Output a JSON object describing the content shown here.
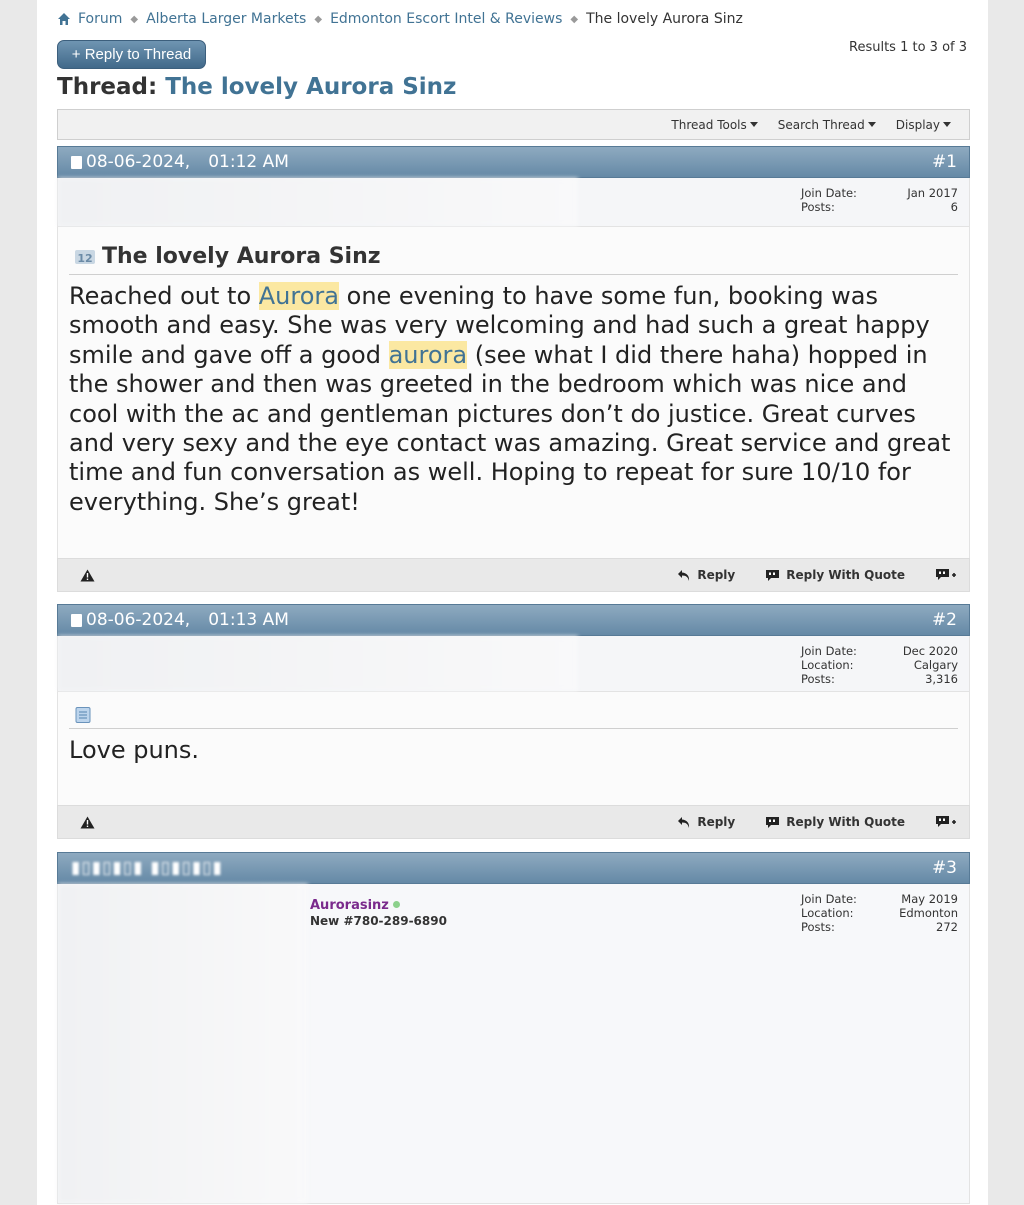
{
  "breadcrumb": {
    "items": [
      "Forum",
      "Alberta Larger Markets",
      "Edmonton Escort Intel & Reviews",
      "The lovely Aurora Sinz"
    ]
  },
  "toolbar": {
    "reply_thread_label": "+ Reply to Thread",
    "results": "Results 1 to 3 of 3"
  },
  "thread": {
    "prefix": "Thread:",
    "title": "The lovely Aurora Sinz"
  },
  "tools": [
    "Thread Tools",
    "Search Thread",
    "Display"
  ],
  "labels": {
    "join_date": "Join Date:",
    "location": "Location:",
    "posts": "Posts:",
    "reply": "Reply",
    "reply_with_quote": "Reply With Quote"
  },
  "posts": [
    {
      "date": "08-06-2024,",
      "time": "01:12 AM",
      "number": "#1",
      "join_date": "Jan 2017",
      "posts": "6",
      "title": "The lovely Aurora Sinz",
      "message_parts": [
        "Reached out to ",
        "Aurora",
        " one evening to have some fun, booking was smooth and easy. She was very welcoming and had such a great happy smile and gave off a good ",
        "aurora",
        " (see what I did there haha) hopped in the shower and then was greeted in the bedroom which was nice and cool with the ac and gentleman pictures don’t do justice. Great curves and very sexy and the eye contact was amazing. Great service and great time and fun conversation as well. Hoping to repeat for sure 10/10 for everything. She’s great!"
      ]
    },
    {
      "date": "08-06-2024,",
      "time": "01:13 AM",
      "number": "#2",
      "join_date": "Dec 2020",
      "location": "Calgary",
      "posts": "3,316",
      "message": "Love puns."
    },
    {
      "date": "",
      "time": "",
      "number": "#3",
      "username": "Aurorasinz",
      "user_title": "New #780-289-6890",
      "join_date": "May 2019",
      "location": "Edmonton",
      "posts": "272"
    }
  ],
  "colors": {
    "link": "#417394",
    "post_header": "#6f92ae",
    "highlight": "#fbe8a2",
    "username": "#7a2a8c"
  }
}
